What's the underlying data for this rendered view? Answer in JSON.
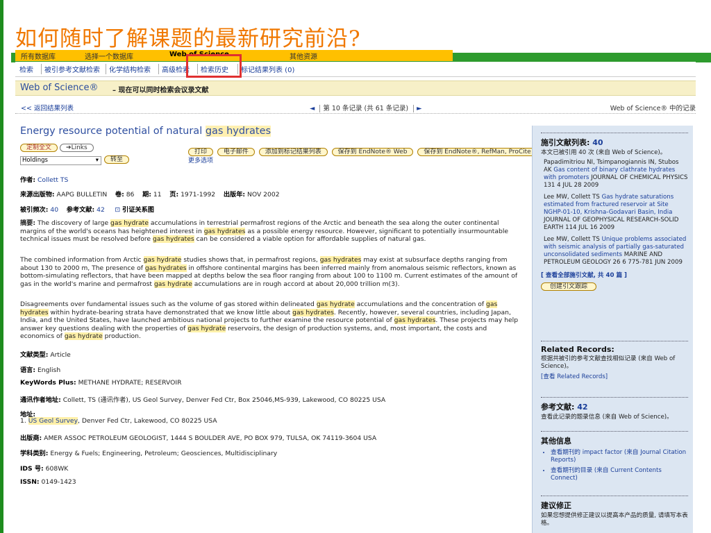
{
  "slide_title": "如何随时了解课题的最新研究前沿?",
  "top_tabs": [
    "所有数据库",
    "选择一个数据库",
    "Web of Science",
    "其他资源"
  ],
  "nav": [
    "检索",
    "被引参考文献检索",
    "化学结构检索",
    "高级检索",
    "检索历史",
    "标记结果列表 (0)"
  ],
  "wos_bar": {
    "title": "Web of Science®",
    "subtitle": "– 现在可以同时检索会议录文献"
  },
  "record_nav": {
    "back": "<< 返回结果列表",
    "prev": "◄",
    "position": "第 10 条记录 (共 61 条记录)",
    "next": "►",
    "right": "Web of Science® 中的记录"
  },
  "article": {
    "title_pre": "Energy resource potential of natural ",
    "title_hl": "gas hydrates",
    "btn_fulltext": "定制全文",
    "btn_links": "➔Links",
    "holdings": "Holdings",
    "btn_go": "转至",
    "btn_print": "打印",
    "btn_email": "电子邮件",
    "btn_mark": "添加到标记结果列表",
    "btn_save_endnote": "保存到 EndNote® Web",
    "btn_save_ref": "保存到 EndNote®, RefMan, ProCite",
    "more_options": "更多选项",
    "authors_label": "作者:",
    "authors": "Collett TS",
    "source_label": "来源出版物:",
    "source": "AAPG BULLETIN",
    "volume_label": "卷:",
    "volume": "86",
    "issue_label": "期:",
    "issue": "11",
    "pages_label": "页:",
    "pages": "1971-1992",
    "date_label": "出版年:",
    "date": "NOV 2002",
    "cited_label": "被引频次:",
    "cited": "40",
    "refs_label": "参考文献:",
    "refs": "42",
    "citation_map": "引证关系图",
    "abstract_label": "摘要:",
    "abstract_p1": "The discovery of large gas hydrate accumulations in terrestrial permafrost regions of the Arctic and beneath the sea along the outer continental margins of the world's oceans has heightened interest in gas hydrates as a possible energy resource. However, significant to potentially insurmountable technical issues must be resolved before gas hydrates can be considered a viable option for affordable supplies of natural gas.",
    "abstract_p2": "The combined information from Arctic gas hydrate studies shows that, in permafrost regions, gas hydrates may exist at subsurface depths ranging from about 130 to 2000 m, The presence of gas hydrates in offshore continental margins has been inferred mainly from anomalous seismic reflectors, known as bottom-simulating reflectors, that have been mapped at depths below the sea floor ranging from about 100 to 1100 m. Current estimates of the amount of gas in the world's marine and permafrost gas hydrate accumulations are in rough accord at about 20,000 trillion m(3).",
    "abstract_p3": "Disagreements over fundamental issues such as the volume of gas stored within delineated gas hydrate accumulations and the concentration of gas hydrates within hydrate-bearing strata have demonstrated that we know little about gas hydrates. Recently, however, several countries, including Japan, India, and the United States, have launched ambitious national projects to further examine the resource potential of gas hydrates. These projects may help answer key questions dealing with the properties of gas hydrate reservoirs, the design of production systems, and, most important, the costs and economics of gas hydrate production.",
    "doctype_label": "文献类型:",
    "doctype": "Article",
    "lang_label": "语言:",
    "lang": "English",
    "keywords_label": "KeyWords Plus:",
    "keywords": "METHANE HYDRATE; RESERVOIR",
    "corr_label": "通讯作者地址:",
    "corr": "Collett, TS (通讯作者), US Geol Survey, Denver Fed Ctr, Box 25046,MS-939, Lakewood, CO 80225 USA",
    "addr_label": "地址:",
    "addr_num": "1.",
    "addr_hl": "US Geol Survey",
    "addr_rest": ", Denver Fed Ctr, Lakewood, CO 80225 USA",
    "publisher_label": "出版商:",
    "publisher": "AMER ASSOC PETROLEUM GEOLOGIST, 1444 S BOULDER AVE, PO BOX 979, TULSA, OK 74119-3604 USA",
    "subject_label": "学科类别:",
    "subject": "Energy & Fuels; Engineering, Petroleum; Geosciences, Multidisciplinary",
    "ids_label": "IDS 号:",
    "ids": "608WK",
    "issn_label": "ISSN:",
    "issn": "0149-1423"
  },
  "sidebar": {
    "citing_title": "施引文献列表:",
    "citing_count": "40",
    "citing_note": "本文已被引用 40 次 (来自 Web of Science)。",
    "citations": [
      {
        "author": "Papadimitriou NI, Tsimpanogiannis IN, Stubos AK",
        "title": "Gas content of binary clathrate hydrates with promoters",
        "source": "JOURNAL OF CHEMICAL PHYSICS 131 4 JUL 28 2009"
      },
      {
        "author": "Lee MW, Collett TS",
        "title": "Gas hydrate saturations estimated from fractured reservoir at Site NGHP-01-10, Krishna-Godavari Basin, India",
        "source": "JOURNAL OF GEOPHYSICAL RESEARCH-SOLID EARTH 114 JUL 16 2009"
      },
      {
        "author": "Lee MW, Collett TS",
        "title": "Unique problems associated with seismic analysis of partially gas-saturated unconsolidated sediments",
        "source": "MARINE AND PETROLEUM GEOLOGY 26 6 775-781 JUN 2009"
      }
    ],
    "view_all": "[ 查看全部施引文献, 共 40 篇 ]",
    "create_alert": "创建引文跟踪",
    "related_title": "Related Records:",
    "related_note": "根据共被引的参考文献查找相似记录 (来自 Web of Science)。",
    "related_link": "[查看 Related Records]",
    "refs_title": "参考文献:",
    "refs_count": "42",
    "refs_note": "查看此记录的题录信息 (来自 Web of Science)。",
    "other_title": "其他信息",
    "other_items": [
      "查看期刊的 impact factor (来自 Journal Citation Reports)",
      "查看期刊的目录 (来自 Current Contents Connect)"
    ],
    "suggest_title": "建议修正",
    "suggest_note": "如果您想提供修正建议以提高本产品的质量, 请填写本表格。"
  }
}
